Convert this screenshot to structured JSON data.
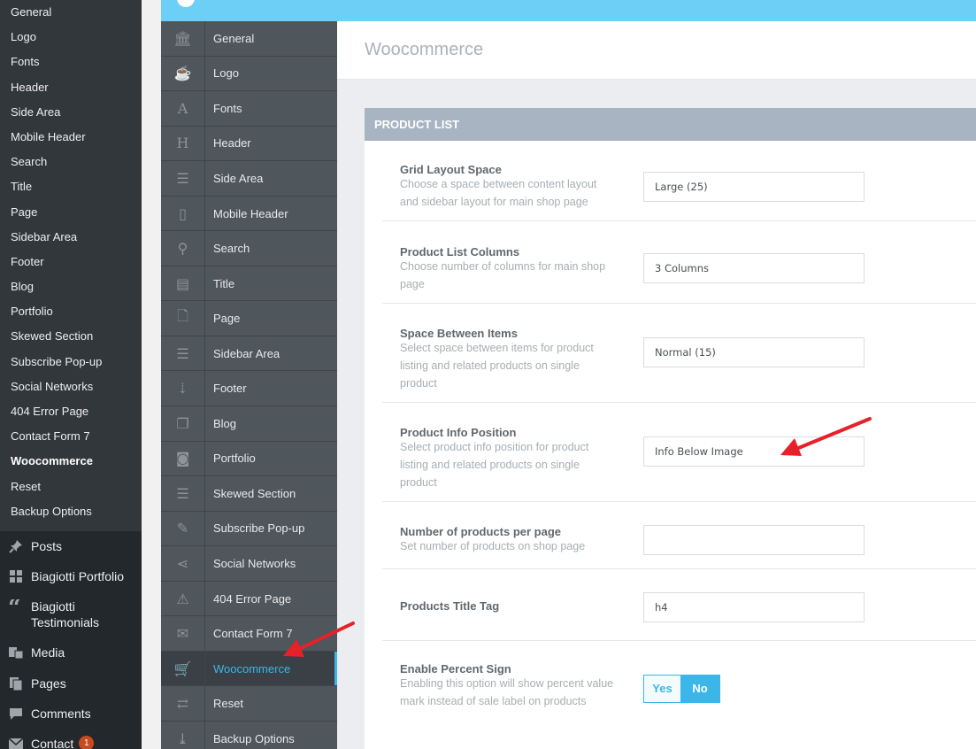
{
  "wp_sidebar": {
    "submenu": [
      "General",
      "Logo",
      "Fonts",
      "Header",
      "Side Area",
      "Mobile Header",
      "Search",
      "Title",
      "Page",
      "Sidebar Area",
      "Footer",
      "Blog",
      "Portfolio",
      "Skewed Section",
      "Subscribe Pop-up",
      "Social Networks",
      "404 Error Page",
      "Contact Form 7",
      "Woocommerce",
      "Reset",
      "Backup Options"
    ],
    "current": "Woocommerce",
    "menu": [
      {
        "label": "Posts",
        "icon": "pin-icon"
      },
      {
        "label": "Biagiotti Portfolio",
        "icon": "grid-icon"
      },
      {
        "label": "Biagiotti Testimonials",
        "icon": "quote-icon"
      },
      {
        "label": "Media",
        "icon": "media-icon"
      },
      {
        "label": "Pages",
        "icon": "pages-icon"
      },
      {
        "label": "Comments",
        "icon": "comment-icon"
      },
      {
        "label": "Contact",
        "icon": "mail-icon",
        "badge": "1"
      }
    ]
  },
  "options_nav": {
    "items": [
      {
        "label": "General",
        "icon": "bank-icon",
        "glyph": "🏛"
      },
      {
        "label": "Logo",
        "icon": "cup-icon",
        "glyph": "☕"
      },
      {
        "label": "Fonts",
        "icon": "font-icon",
        "glyph": "A"
      },
      {
        "label": "Header",
        "icon": "heading-icon",
        "glyph": "H"
      },
      {
        "label": "Side Area",
        "icon": "indent-icon",
        "glyph": "☰"
      },
      {
        "label": "Mobile Header",
        "icon": "mobile-icon",
        "glyph": "▯"
      },
      {
        "label": "Search",
        "icon": "search-icon",
        "glyph": "⚲"
      },
      {
        "label": "Title",
        "icon": "window-icon",
        "glyph": "▤"
      },
      {
        "label": "Page",
        "icon": "file-icon",
        "glyph": "🗋"
      },
      {
        "label": "Sidebar Area",
        "icon": "indent-icon",
        "glyph": "☰"
      },
      {
        "label": "Footer",
        "icon": "sort-icon",
        "glyph": "⇣"
      },
      {
        "label": "Blog",
        "icon": "copy-icon",
        "glyph": "❐"
      },
      {
        "label": "Portfolio",
        "icon": "camera-icon",
        "glyph": "◙"
      },
      {
        "label": "Skewed Section",
        "icon": "indent-icon",
        "glyph": "☰"
      },
      {
        "label": "Subscribe Pop-up",
        "icon": "edit-icon",
        "glyph": "✎"
      },
      {
        "label": "Social Networks",
        "icon": "share-icon",
        "glyph": "⋖"
      },
      {
        "label": "404 Error Page",
        "icon": "warning-icon",
        "glyph": "⚠"
      },
      {
        "label": "Contact Form 7",
        "icon": "envelope-icon",
        "glyph": "✉"
      },
      {
        "label": "Woocommerce",
        "icon": "cart-icon",
        "glyph": "🛒"
      },
      {
        "label": "Reset",
        "icon": "retweet-icon",
        "glyph": "⇄"
      },
      {
        "label": "Backup Options",
        "icon": "download-icon",
        "glyph": "⤓"
      }
    ],
    "active": "Woocommerce"
  },
  "content": {
    "page_title": "Woocommerce",
    "section_title": "PRODUCT LIST",
    "options": [
      {
        "title": "Grid Layout Space",
        "desc": "Choose a space between content layout and sidebar layout for main shop page",
        "value": "Large (25)"
      },
      {
        "title": "Product List Columns",
        "desc": "Choose number of columns for main shop page",
        "value": "3 Columns"
      },
      {
        "title": "Space Between Items",
        "desc": "Select space between items for product listing and related products on single product",
        "value": "Normal (15)"
      },
      {
        "title": "Product Info Position",
        "desc": "Select product info position for product listing and related products on single product",
        "value": "Info Below Image"
      },
      {
        "title": "Number of products per page",
        "desc": "Set number of products on shop page",
        "value": ""
      },
      {
        "title": "Products Title Tag",
        "desc": "",
        "value": "h4"
      },
      {
        "title": "Enable Percent Sign",
        "desc": "Enabling this option will show percent value mark instead of sale label on products",
        "toggle": {
          "yes": "Yes",
          "no": "No",
          "selected": "No"
        }
      }
    ]
  },
  "colors": {
    "accent": "#3bb6e8",
    "annotation_arrow": "#e8202a",
    "topbar": "#6dcff6"
  }
}
